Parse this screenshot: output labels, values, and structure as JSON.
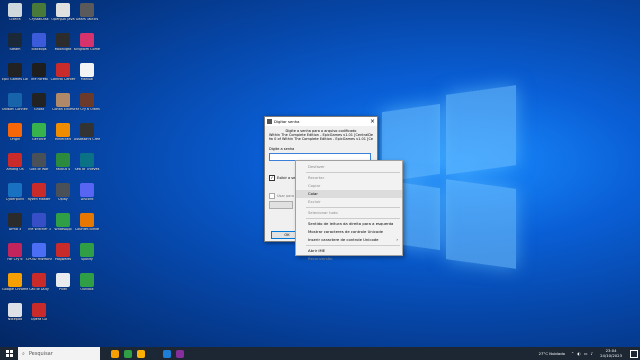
{
  "desktop": {
    "icons": [
      {
        "label": "Lixeira",
        "color": "#cfd8dc"
      },
      {
        "label": "CrystalDisk",
        "color": "#4a7a3a"
      },
      {
        "label": "OpenJDK Java",
        "color": "#e0e0e0"
      },
      {
        "label": "Gears Tactics",
        "color": "#5a5a5a"
      },
      {
        "label": "Steam",
        "color": "#1b2838"
      },
      {
        "label": "Blackops",
        "color": "#3b5bdb"
      },
      {
        "label": "Moonlight",
        "color": "#2c2c2c"
      },
      {
        "label": "Kingdom Come",
        "color": "#d6336c"
      },
      {
        "label": "Epic Games Launcher",
        "color": "#222"
      },
      {
        "label": "The Forest",
        "color": "#1e1e1e"
      },
      {
        "label": "Control Center",
        "color": "#c92a2a"
      },
      {
        "label": "Manual",
        "color": "#f1f3f5"
      },
      {
        "label": "Ubisoft Connect",
        "color": "#1864ab"
      },
      {
        "label": "Ghost",
        "color": "#222"
      },
      {
        "label": "Conan Exiles",
        "color": "#b08968"
      },
      {
        "label": "Far Cry 6 Ultimate",
        "color": "#6b3a2a"
      },
      {
        "label": "Origin",
        "color": "#f76707"
      },
      {
        "label": "GeForce",
        "color": "#37b24d"
      },
      {
        "label": "Minecraft",
        "color": "#f08c00"
      },
      {
        "label": "Assassin's Creed Valhalla",
        "color": "#333"
      },
      {
        "label": "Among Us",
        "color": "#c92a2a"
      },
      {
        "label": "God of War",
        "color": "#495057"
      },
      {
        "label": "Fallout 4",
        "color": "#2b8a3e"
      },
      {
        "label": "Sea of Thieves",
        "color": "#0b7285"
      },
      {
        "label": "Cyberpunk",
        "color": "#1971c2"
      },
      {
        "label": "Ryzen Master",
        "color": "#c92a2a"
      },
      {
        "label": "Uplay",
        "color": "#495057"
      },
      {
        "label": "Discord",
        "color": "#5865f2"
      },
      {
        "label": "Arma 3",
        "color": "#2b2b2b"
      },
      {
        "label": "The Witcher 3",
        "color": "#364fc7"
      },
      {
        "label": "WhatsApp",
        "color": "#2f9e44"
      },
      {
        "label": "Counter-Strike",
        "color": "#e67700"
      },
      {
        "label": "Far Cry 6",
        "color": "#c2255c"
      },
      {
        "label": "CPUID HWMonitor",
        "color": "#4c6ef5"
      },
      {
        "label": "Hogwarts",
        "color": "#c92a2a"
      },
      {
        "label": "Spotify",
        "color": "#2f9e44"
      },
      {
        "label": "Google Chrome",
        "color": "#f59f00"
      },
      {
        "label": "Call of Duty",
        "color": "#c92a2a"
      },
      {
        "label": "Pixel",
        "color": "#e9ecef"
      },
      {
        "label": "Outlook",
        "color": "#2f9e44"
      },
      {
        "label": "Notepad",
        "color": "#dee2e6"
      },
      {
        "label": "Opera GX",
        "color": "#c92a2a"
      }
    ]
  },
  "dialog": {
    "title": "Digitar senha",
    "close": "×",
    "prompt": "Digite a senha para o arquivo codificado",
    "file_line1": "Within The Complete Edition - EpicGames v1.01 [CentralDeTraducoes]",
    "file_line2": "fw 0 of Within The Complete Edition - EpicGames v1.01 [CentralDeTr",
    "field_label": "Digite a senha",
    "show_password": "Exibir a senha",
    "use_for_all": "Usar para todos",
    "ok": "OK"
  },
  "context_menu": {
    "items": [
      {
        "label": "Desfazer",
        "disabled": true
      },
      {
        "sep": true
      },
      {
        "label": "Recortar",
        "disabled": true
      },
      {
        "label": "Copiar",
        "disabled": true
      },
      {
        "label": "Colar",
        "disabled": false,
        "highlight": true
      },
      {
        "label": "Excluir",
        "disabled": true
      },
      {
        "sep": true
      },
      {
        "label": "Selecionar tudo",
        "disabled": true
      },
      {
        "sep": true
      },
      {
        "label": "Sentido de leitura da direita para a esquerda",
        "disabled": false
      },
      {
        "label": "Mostrar caracteres de controle Unicode",
        "disabled": false
      },
      {
        "label": "Inserir caractere de controle Unicode",
        "disabled": false,
        "submenu": true
      },
      {
        "sep": true
      },
      {
        "label": "Abrir IME",
        "disabled": false
      },
      {
        "label": "Reconversão",
        "disabled": true
      }
    ]
  },
  "taskbar": {
    "search_placeholder": "Pesquisar",
    "apps": [
      {
        "name": "chrome-icon",
        "color": "#f59f00"
      },
      {
        "name": "whatsapp-icon",
        "color": "#2f9e44"
      },
      {
        "name": "file-explorer-icon",
        "color": "#fab005"
      },
      {
        "name": "steam-icon",
        "color": "#1b2838"
      },
      {
        "name": "edge-icon",
        "color": "#1c7ed6"
      },
      {
        "name": "winrar-icon",
        "color": "#862e9c"
      }
    ],
    "weather": "27°C  Nublado",
    "time": "23:04",
    "date": "24/10/2023"
  }
}
